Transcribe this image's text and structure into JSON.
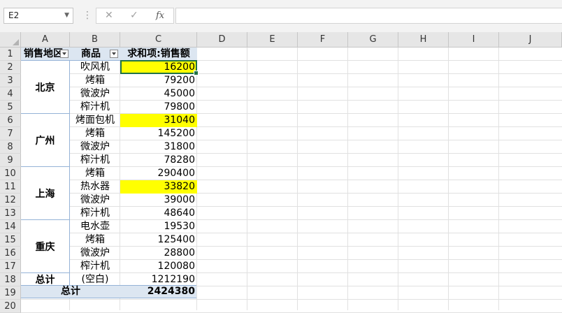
{
  "formula_bar": {
    "name_box": "E2",
    "cancel_icon": "✕",
    "enter_icon": "✓",
    "fx_label": "fx",
    "formula_value": ""
  },
  "columns": [
    "A",
    "B",
    "C",
    "D",
    "E",
    "F",
    "G",
    "H",
    "I",
    "J"
  ],
  "rows": [
    "1",
    "2",
    "3",
    "4",
    "5",
    "6",
    "7",
    "8",
    "9",
    "10",
    "11",
    "12",
    "13",
    "14",
    "15",
    "16",
    "17",
    "18",
    "19",
    "20"
  ],
  "pivot": {
    "header_region": "销售地区",
    "header_product": "商品",
    "header_sum": "求和项:销售额",
    "regions": [
      "北京",
      "广州",
      "上海",
      "重庆",
      "总计"
    ],
    "items": [
      {
        "product": "吹风机",
        "value": "16200"
      },
      {
        "product": "烤箱",
        "value": "79200"
      },
      {
        "product": "微波炉",
        "value": "45000"
      },
      {
        "product": "榨汁机",
        "value": "79800"
      },
      {
        "product": "烤面包机",
        "value": "31040"
      },
      {
        "product": "烤箱",
        "value": "145200"
      },
      {
        "product": "微波炉",
        "value": "31800"
      },
      {
        "product": "榨汁机",
        "value": "78280"
      },
      {
        "product": "烤箱",
        "value": "290400"
      },
      {
        "product": "热水器",
        "value": "33820"
      },
      {
        "product": "微波炉",
        "value": "39000"
      },
      {
        "product": "榨汁机",
        "value": "48640"
      },
      {
        "product": "电水壶",
        "value": "19530"
      },
      {
        "product": "烤箱",
        "value": "125400"
      },
      {
        "product": "微波炉",
        "value": "28800"
      },
      {
        "product": "榨汁机",
        "value": "120080"
      },
      {
        "product": "(空白)",
        "value": "1212190"
      }
    ],
    "grand_total_label": "总计",
    "grand_total_value": "2424380"
  },
  "colors": {
    "highlight": "#ffff00",
    "pivot_header": "#dce6f1",
    "selection": "#217346"
  }
}
